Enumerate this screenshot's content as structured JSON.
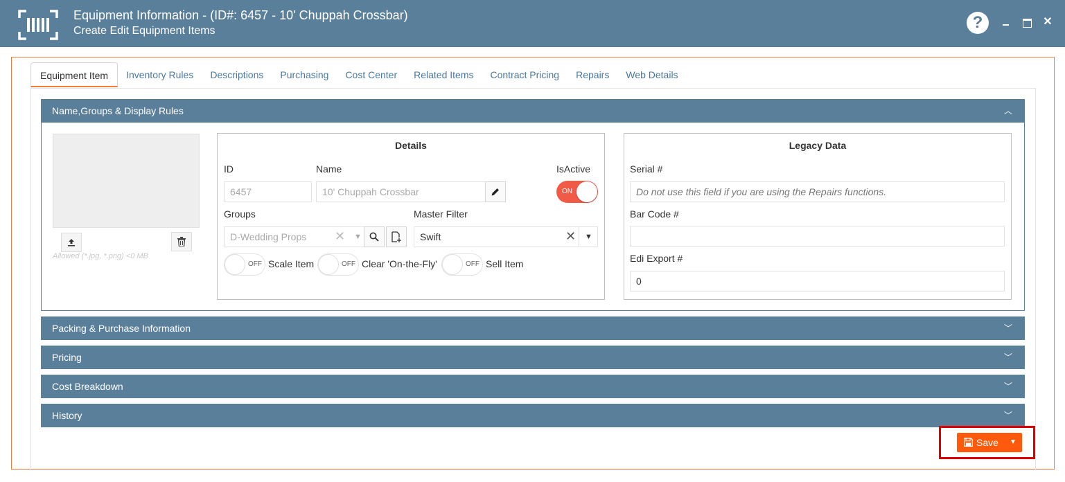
{
  "window": {
    "title": "Equipment Information - (ID#: 6457 - 10' Chuppah Crossbar)",
    "subtitle": "Create Edit Equipment Items",
    "help_glyph": "?",
    "close_glyph": "✕"
  },
  "tabs": [
    {
      "label": "Equipment Item",
      "active": true
    },
    {
      "label": "Inventory Rules"
    },
    {
      "label": "Descriptions"
    },
    {
      "label": "Purchasing"
    },
    {
      "label": "Cost Center"
    },
    {
      "label": "Related Items"
    },
    {
      "label": "Contract Pricing"
    },
    {
      "label": "Repairs"
    },
    {
      "label": "Web Details"
    }
  ],
  "sections": {
    "name_groups": {
      "label": "Name,Groups & Display Rules",
      "expanded": true
    },
    "packing": {
      "label": "Packing & Purchase Information",
      "expanded": false
    },
    "pricing": {
      "label": "Pricing",
      "expanded": false
    },
    "cost_breakdown": {
      "label": "Cost Breakdown",
      "expanded": false
    },
    "history": {
      "label": "History",
      "expanded": false
    }
  },
  "image": {
    "hint": "Allowed (*.jpg, *.png) <0 MB"
  },
  "details": {
    "title": "Details",
    "id_label": "ID",
    "id_value": "6457",
    "name_label": "Name",
    "name_value": "10' Chuppah Crossbar",
    "isactive_label": "IsActive",
    "isactive_state": "ON",
    "groups_label": "Groups",
    "groups_value": "D-Wedding Props",
    "master_filter_label": "Master Filter",
    "master_filter_value": "Swift",
    "toggles": [
      {
        "label": "Scale Item",
        "state": "OFF"
      },
      {
        "label": "Clear 'On-the-Fly'",
        "state": "OFF"
      },
      {
        "label": "Sell Item",
        "state": "OFF"
      }
    ]
  },
  "legacy": {
    "title": "Legacy Data",
    "serial_label": "Serial #",
    "serial_placeholder": "Do not use this field if you are using the Repairs functions.",
    "barcode_label": "Bar Code #",
    "barcode_value": "",
    "edi_label": "Edi Export #",
    "edi_value": "0"
  },
  "actions": {
    "save_label": "Save"
  },
  "colors": {
    "header_bg": "#5a7f9b",
    "accent": "#f47a3b",
    "save_bg": "#ff5a0b",
    "toggle_on": "#f25a48",
    "highlight": "#e10000"
  }
}
